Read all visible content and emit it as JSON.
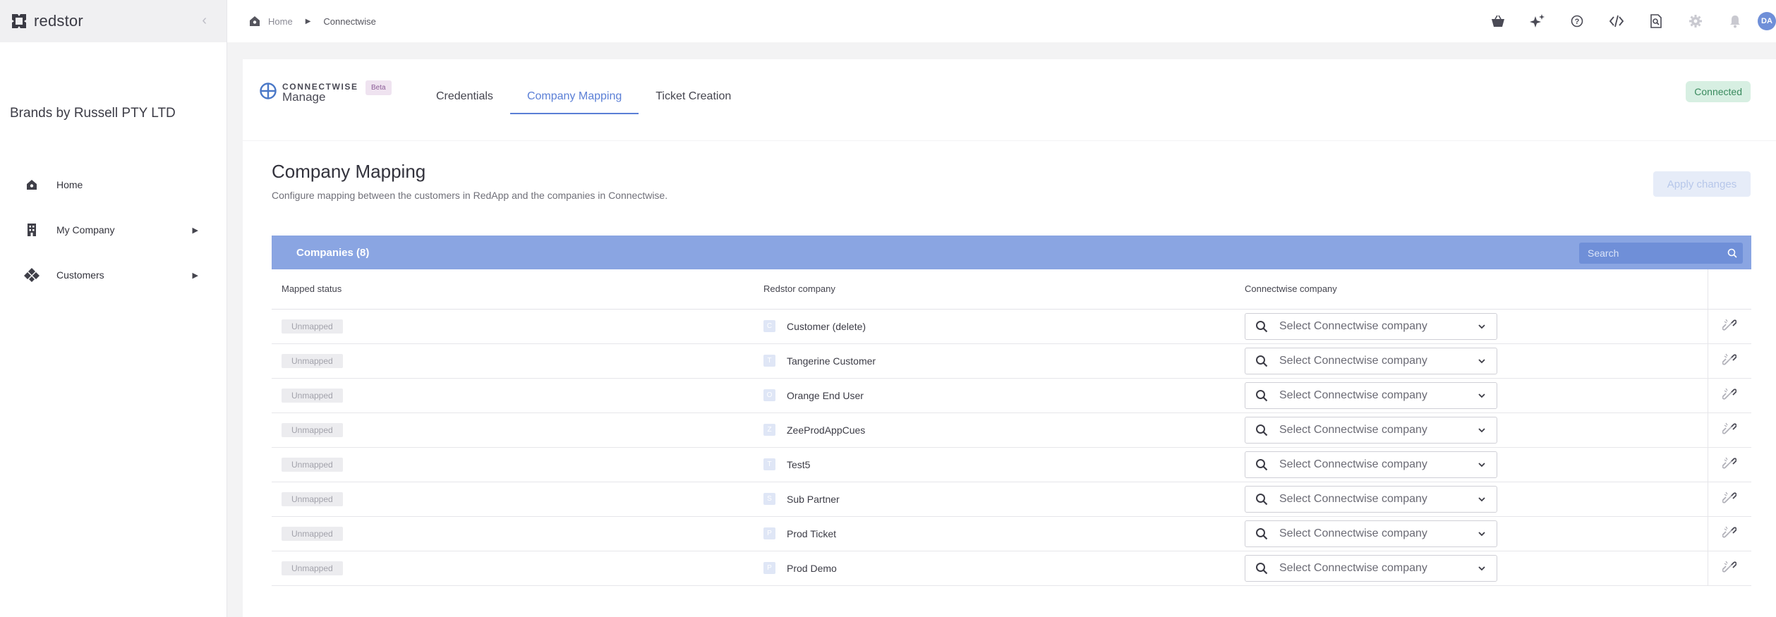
{
  "brand": {
    "name": "redstor"
  },
  "sidebar": {
    "org_name": "Brands by Russell PTY LTD",
    "items": [
      {
        "label": "Home",
        "icon": "home-icon",
        "expandable": false
      },
      {
        "label": "My Company",
        "icon": "building-icon",
        "expandable": true
      },
      {
        "label": "Customers",
        "icon": "customers-icon",
        "expandable": true
      }
    ]
  },
  "breadcrumb": {
    "home": "Home",
    "current": "Connectwise"
  },
  "topbar": {
    "icons": [
      "basket-icon",
      "sparkle-icon",
      "help-icon",
      "code-icon",
      "search-doc-icon",
      "gear-icon",
      "bell-icon"
    ],
    "avatar_initials": "DA"
  },
  "integration": {
    "logo_top": "CONNECTWISE",
    "logo_bottom": "Manage",
    "badge": "Beta",
    "tabs": [
      "Credentials",
      "Company Mapping",
      "Ticket Creation"
    ],
    "active_tab": "Company Mapping",
    "status": "Connected"
  },
  "mapping": {
    "title": "Company Mapping",
    "subtitle": "Configure mapping between the customers in RedApp and the companies in Connectwise.",
    "apply_label": "Apply changes",
    "companies_label": "Companies (8)",
    "search_placeholder": "Search",
    "columns": [
      "Mapped status",
      "Redstor company",
      "Connectwise company"
    ],
    "select_placeholder": "Select Connectwise company",
    "rows": [
      {
        "status": "Unmapped",
        "initial": "C",
        "company": "Customer (delete)"
      },
      {
        "status": "Unmapped",
        "initial": "T",
        "company": "Tangerine Customer"
      },
      {
        "status": "Unmapped",
        "initial": "O",
        "company": "Orange End User"
      },
      {
        "status": "Unmapped",
        "initial": "Z",
        "company": "ZeeProdAppCues"
      },
      {
        "status": "Unmapped",
        "initial": "T",
        "company": "Test5"
      },
      {
        "status": "Unmapped",
        "initial": "S",
        "company": "Sub Partner"
      },
      {
        "status": "Unmapped",
        "initial": "P",
        "company": "Prod Ticket"
      },
      {
        "status": "Unmapped",
        "initial": "P",
        "company": "Prod Demo"
      }
    ]
  },
  "colors": {
    "accent": "#5b7fd6",
    "table_header": "#8aa5e2",
    "connected_bg": "#d7efe2",
    "connected_text": "#3a8a5e"
  }
}
